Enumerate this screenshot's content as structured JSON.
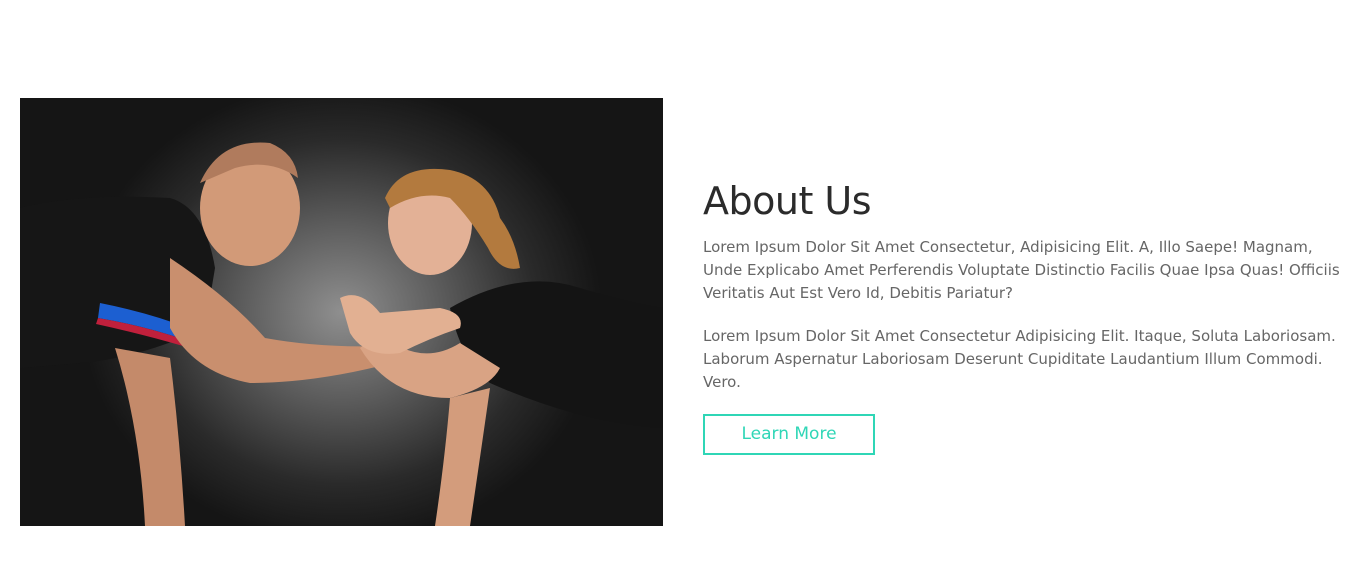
{
  "about": {
    "title": "About Us",
    "paragraph1": "Lorem Ipsum Dolor Sit Amet Consectetur, Adipisicing Elit. A, Illo Saepe! Magnam, Unde Explicabo Amet Perferendis Voluptate Distinctio Facilis Quae Ipsa Quas! Officiis Veritatis Aut Est Vero Id, Debitis Pariatur?",
    "paragraph2": "Lorem Ipsum Dolor Sit Amet Consectetur Adipisicing Elit. Itaque, Soluta Laboriosam. Laborum Aspernatur Laboriosam Deserunt Cupiditate Laudantium Illum Commodi. Vero.",
    "button_label": "Learn More"
  },
  "colors": {
    "accent": "#2fd6b6",
    "heading": "#2b2b2b",
    "body_text": "#666666"
  }
}
